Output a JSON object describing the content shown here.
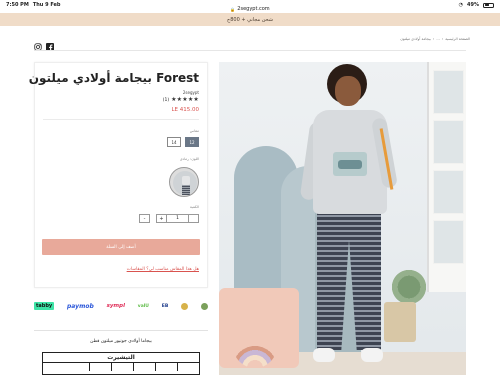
{
  "statusbar": {
    "time": "7:50 PM",
    "date": "Thu 9 Feb",
    "battery": "49%"
  },
  "browser": {
    "url": "2segypt.com"
  },
  "announcement": {
    "text": "شحن مجاني + 800ج"
  },
  "header": {
    "breadcrumb": [
      "الصفحة الرئيسية",
      "...",
      "بيجامة أولادي ميلتون"
    ]
  },
  "product": {
    "title": "Forest بيجامة أولادي ميلتون",
    "vendor": "2segypt",
    "rating_stars": 5,
    "rating_count": "(1)",
    "price": "LE 415.00",
    "size_label": "مقاس",
    "sizes": [
      {
        "label": "12",
        "selected": true
      },
      {
        "label": "14",
        "selected": false
      }
    ],
    "color_label": "اللون: رمادي",
    "qty_label": "الكمية",
    "qty_value": "1",
    "qty_plus": "+",
    "qty_minus": "-",
    "add_to_cart": "أضف إلى السلة",
    "size_help_link": "هل هذا المقاس مناسب لي؟ المقاسات"
  },
  "payments": {
    "logos": [
      "tabby",
      "paymob",
      "sympl",
      "valU",
      "EB",
      "bank-logo",
      "bank-logo"
    ],
    "tabby": "tabby",
    "paymob": "paymob",
    "sympl": "sympl",
    "valu": "valU",
    "eb": "EB"
  },
  "description": {
    "text": "بيجاما أولادي جونيور ميلتون قطن",
    "table_title": "التيشيرت"
  },
  "colors": {
    "accent": "#e8a99a",
    "price": "#d9534f",
    "size_selected": "#6a7787",
    "announce_bg": "#f0dcc8"
  }
}
